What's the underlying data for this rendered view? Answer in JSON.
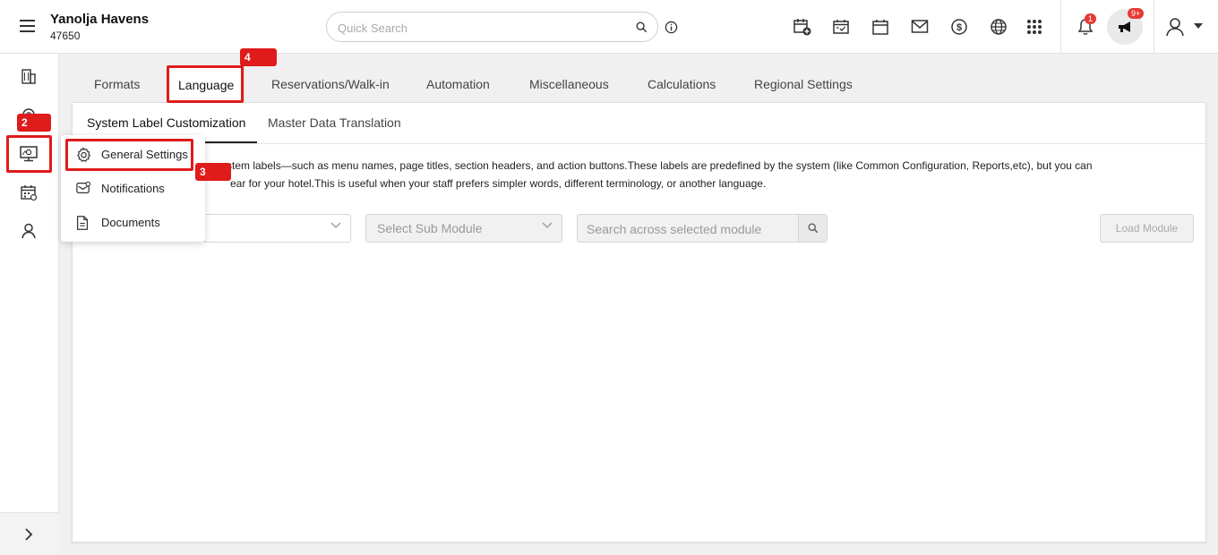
{
  "header": {
    "hotel_name": "Yanolja Havens",
    "hotel_id": "47650",
    "search_placeholder": "Quick Search",
    "notification_count": "1",
    "announcement_count": "9+"
  },
  "sidebar": {
    "items": [
      {
        "icon": "building-icon"
      },
      {
        "icon": "settings-icon"
      },
      {
        "icon": "monitor-settings-icon"
      },
      {
        "icon": "calendar-icon"
      },
      {
        "icon": "user-icon"
      }
    ],
    "expand_icon": "chevron-right-icon"
  },
  "annotations": {
    "badge_2": "2",
    "badge_3": "3",
    "badge_4": "4",
    "color": "#e01b1b"
  },
  "tabs": [
    {
      "label": "Formats"
    },
    {
      "label": "Language",
      "active": true
    },
    {
      "label": "Reservations/Walk-in"
    },
    {
      "label": "Automation"
    },
    {
      "label": "Miscellaneous"
    },
    {
      "label": "Calculations"
    },
    {
      "label": "Regional Settings"
    }
  ],
  "subtabs": [
    {
      "label": "System Label Customization",
      "active": true
    },
    {
      "label": "Master Data Translation"
    }
  ],
  "description": {
    "line1": "ystem labels—such as menu names, page titles, section headers, and action buttons.These labels are predefined by the system (like Common Configuration, Reports,etc), but you can",
    "line2": "ear for your hotel.This is useful when your staff prefers simpler words, different terminology, or another language."
  },
  "filters": {
    "sub_module_placeholder": "Select Sub Module",
    "search_placeholder": "Search across selected module",
    "load_button": "Load Module"
  },
  "dropdown_menu": {
    "items": [
      {
        "label": "General Settings",
        "icon": "gear-icon"
      },
      {
        "label": "Notifications",
        "icon": "mail-icon"
      },
      {
        "label": "Documents",
        "icon": "document-icon"
      }
    ]
  }
}
